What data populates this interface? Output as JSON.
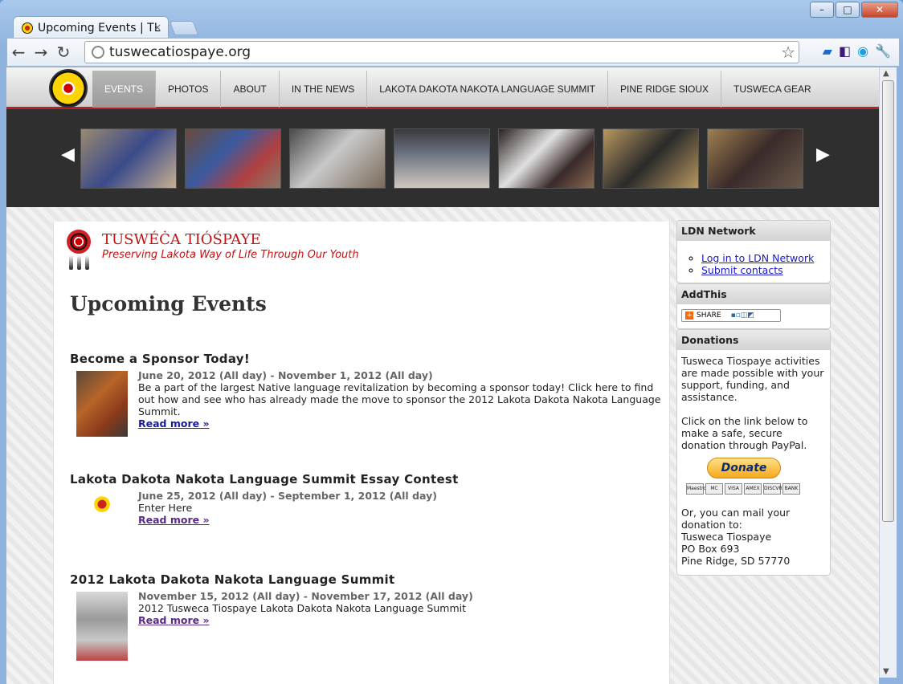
{
  "browser": {
    "tab_title": "Upcoming Events | TL",
    "tab_close": "×",
    "url": "tuswecatiospaye.org",
    "window_buttons": [
      "–",
      "□",
      "✕"
    ]
  },
  "site_nav": {
    "items": [
      "EVENTS",
      "PHOTOS",
      "ABOUT",
      "IN THE NEWS",
      "LAKOTA DAKOTA NAKOTA LANGUAGE SUMMIT",
      "PINE RIDGE SIOUX",
      "TUSWECA GEAR"
    ]
  },
  "slider": {
    "prev": "◀",
    "next": "▶",
    "thumb_colors": [
      "#6a6a8a",
      "#7a5a4a",
      "#5a5a5a",
      "#6a6a6a",
      "#4a3a3a",
      "#8a7050",
      "#6b5535"
    ]
  },
  "brand": {
    "title": "TUSWÉĊA TIÓŚPAYE",
    "tagline": "Preserving Lakota Way of Life Through Our Youth"
  },
  "page_title": "Upcoming Events",
  "events": [
    {
      "title": "Become a Sponsor Today!",
      "date": "June 20, 2012 (All day) - November 1, 2012 (All day)",
      "text": "Be a part of the largest Native language revitalization by becoming a sponsor today! Click here to find out how and see who has already made the move to sponsor the 2012 Lakota Dakota Nakota Language Summit.",
      "read_more": "Read more »"
    },
    {
      "title": "Lakota Dakota Nakota Language Summit Essay Contest",
      "date": "June 25, 2012 (All day) - September 1, 2012 (All day)",
      "text": " Enter Here",
      "read_more": "Read more »"
    },
    {
      "title": "2012 Lakota Dakota Nakota Language Summit",
      "date": "November 15, 2012 (All day) - November 17, 2012 (All day)",
      "text": " 2012 Tusweca Tiospaye  Lakota Dakota Nakota Language Summit",
      "read_more": "Read more »"
    }
  ],
  "sidebar": {
    "ldn": {
      "heading": "LDN Network",
      "links": [
        "Log in to LDN Network",
        "Submit contacts"
      ]
    },
    "addthis": {
      "heading": "AddThis",
      "share_label": "SHARE"
    },
    "donations": {
      "heading": "Donations",
      "p1": "Tusweca Tiospaye activities are made possible with your support, funding, and assistance.",
      "p2": "Click on the link below to make a safe, secure donation through PayPal.",
      "donate_button": "Donate",
      "cards": [
        "Maestro",
        "MC",
        "VISA",
        "AMEX",
        "DISCVR",
        "BANK"
      ],
      "mail_intro": "Or, you can mail your donation to:",
      "address_name": "Tusweca Tiospaye",
      "address_po": "PO Box 693",
      "address_city": "Pine Ridge, SD 57770"
    }
  }
}
